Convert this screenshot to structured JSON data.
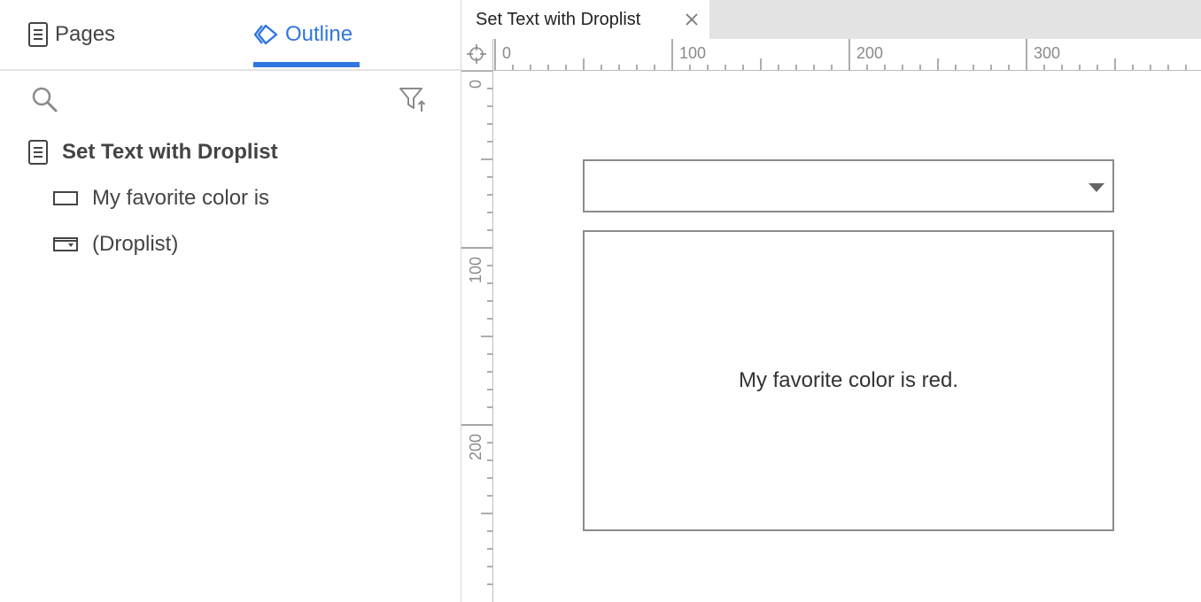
{
  "left_panel": {
    "tabs": {
      "pages": "Pages",
      "outline": "Outline"
    },
    "tree": {
      "page": "Set Text with Droplist",
      "items": [
        "My favorite color is",
        "(Droplist)"
      ]
    }
  },
  "editor": {
    "tab_title": "Set Text with Droplist",
    "ruler": {
      "top_labels": [
        "0",
        "100",
        "200",
        "300"
      ],
      "left_labels": [
        "0",
        "100",
        "200"
      ]
    }
  },
  "canvas": {
    "droplist": {
      "selected": ""
    },
    "text_box": {
      "text": "My favorite color is red."
    }
  },
  "colors": {
    "accent": "#2f76e0",
    "border": "#8a8a8a",
    "tab_bar": "#e3e3e3"
  }
}
